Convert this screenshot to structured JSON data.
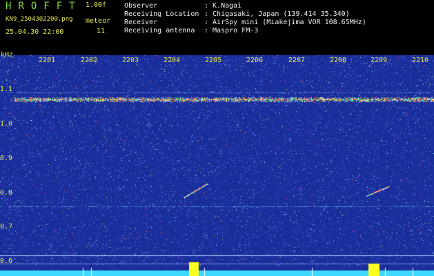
{
  "header": {
    "app_title": "HROFFT",
    "version": "1.00f",
    "filename": "KN9_2504302200.png",
    "datetime": "25.04.30 22:00",
    "meteor_label": "meteor",
    "meteor_count": "11"
  },
  "info": [
    {
      "label": "Observer",
      "value": ": K.Nagai"
    },
    {
      "label": "Receiving Location",
      "value": ": Chigasaki, Japan (139.414 35.340)"
    },
    {
      "label": "Receiver",
      "value": ": AirSpy mini (Miakejima VOR 108.65MHz)"
    },
    {
      "label": "Receiving antenna",
      "value": ": Maspro FM-3"
    }
  ],
  "axis": {
    "y_unit": "kHz",
    "y_ticks": [
      "1.1",
      "1.0",
      "0.9",
      "0.8",
      "0.7",
      "0.6"
    ],
    "x_ticks": [
      "2201",
      "2202",
      "2203",
      "2204",
      "2205",
      "2206",
      "2207",
      "2208",
      "2209",
      "2210"
    ]
  },
  "colors": {
    "background": "#1a2e9c",
    "label_yellow": "#e8e850",
    "title_green": "#7fdc3c",
    "info_white": "#f0f0f0",
    "baseline_cyan": "#3fd8ff",
    "burst_yellow": "#ffff20"
  }
}
